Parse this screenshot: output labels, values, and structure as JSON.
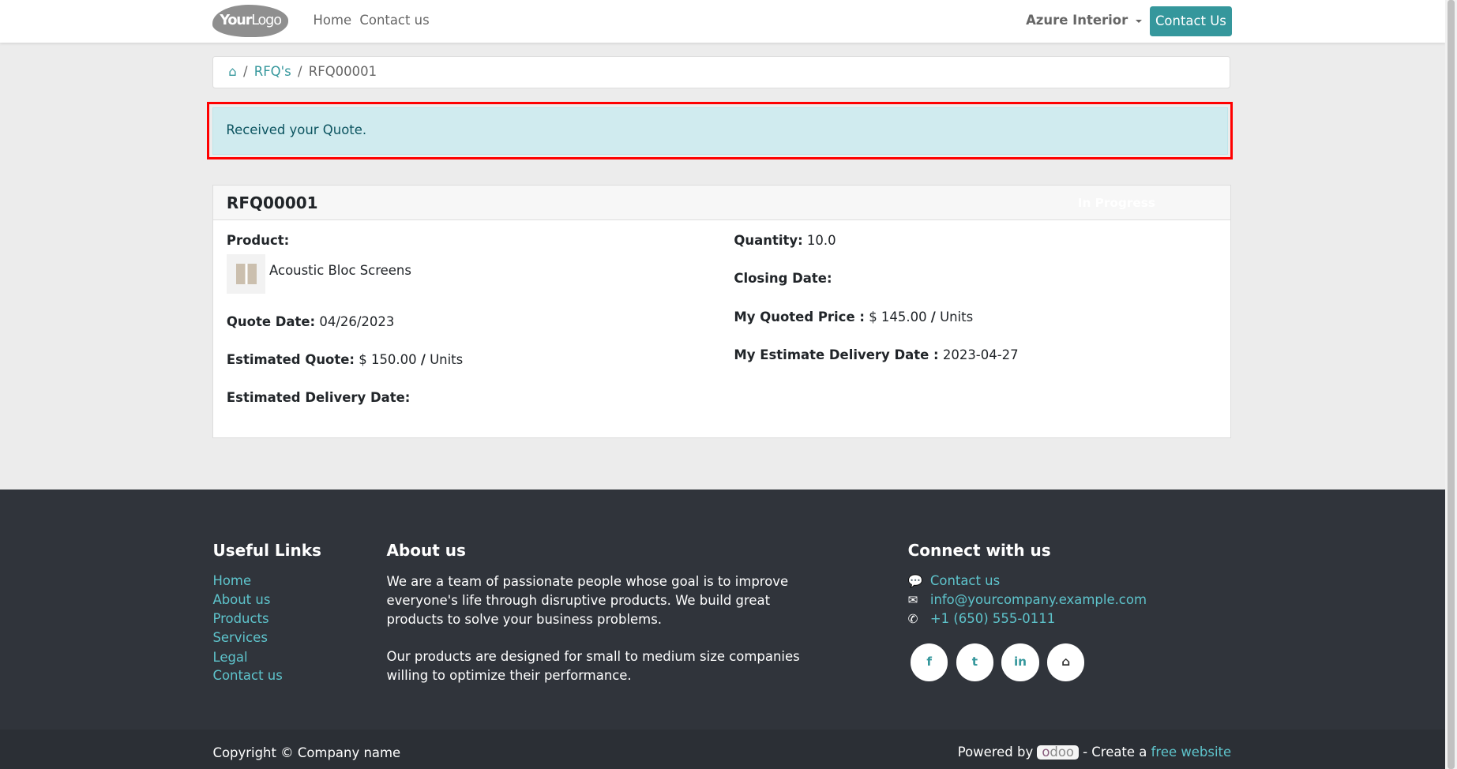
{
  "nav": {
    "logo": "YourLogo",
    "links": [
      "Home",
      "Contact us"
    ],
    "company": "Azure Interior",
    "contact_button": "Contact Us"
  },
  "breadcrumb": {
    "home_icon": "home-icon",
    "items": [
      "RFQ's",
      "RFQ00001"
    ]
  },
  "alert": {
    "message": "Received your Quote."
  },
  "rfq": {
    "title": "RFQ00001",
    "status": "In Progress",
    "product_label": "Product:",
    "product_name": "Acoustic Bloc Screens",
    "quote_date_label": "Quote Date:",
    "quote_date": "04/26/2023",
    "estimated_quote_label": "Estimated Quote:",
    "estimated_quote": "$ 150.00",
    "estimated_quote_unit": "Units",
    "estimated_delivery_label": "Estimated Delivery Date:",
    "quantity_label": "Quantity:",
    "quantity": "10.0",
    "closing_date_label": "Closing Date:",
    "quoted_price_label": "My Quoted Price :",
    "quoted_price": "$ 145.00",
    "quoted_price_unit": "Units",
    "my_delivery_label": "My Estimate Delivery Date :",
    "my_delivery": "2023-04-27",
    "slash": "/"
  },
  "footer": {
    "useful_title": "Useful Links",
    "useful_links": [
      "Home",
      "About us",
      "Products",
      "Services",
      "Legal",
      "Contact us"
    ],
    "about_title": "About us",
    "about_p1": "We are a team of passionate people whose goal is to improve everyone's life through disruptive products. We build great products to solve your business problems.",
    "about_p2": "Our products are designed for small to medium size companies willing to optimize their performance.",
    "connect_title": "Connect with us",
    "contact": "Contact us",
    "email": "info@yourcompany.example.com",
    "phone": "+1 (650) 555-0111",
    "social": [
      "facebook-icon",
      "twitter-icon",
      "linkedin-icon",
      "home-icon"
    ]
  },
  "bottom": {
    "copyright": "Copyright © Company name",
    "powered": "Powered by",
    "odoo": "odoo",
    "create": "- Create a",
    "free_website": "free website"
  },
  "colors": {
    "primary": "#35979c",
    "alert_bg": "#d0ebef",
    "highlight": "#ff0000",
    "footer_bg": "#30343b"
  }
}
